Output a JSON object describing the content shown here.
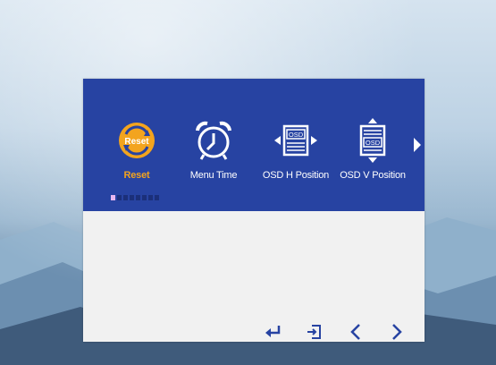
{
  "menu": {
    "items": [
      {
        "label": "Reset",
        "badge": "Reset",
        "icon": "reset-icon",
        "selected": true
      },
      {
        "label": "Menu Time",
        "icon": "alarm-clock-icon",
        "selected": false
      },
      {
        "label": "OSD H Position",
        "badge": "OSD",
        "icon": "osd-h-position-icon",
        "selected": false
      },
      {
        "label": "OSD V Position",
        "badge": "OSD",
        "icon": "osd-v-position-icon",
        "selected": false
      }
    ],
    "page_indicator": {
      "count": 8,
      "current": 1
    }
  },
  "nav_keys": [
    "enter-icon",
    "exit-icon",
    "left-arrow-icon",
    "right-arrow-icon"
  ],
  "colors": {
    "header": "#2743a2",
    "active": "#f3a41e",
    "body": "#f1f1f1",
    "nav": "#2743a2"
  }
}
